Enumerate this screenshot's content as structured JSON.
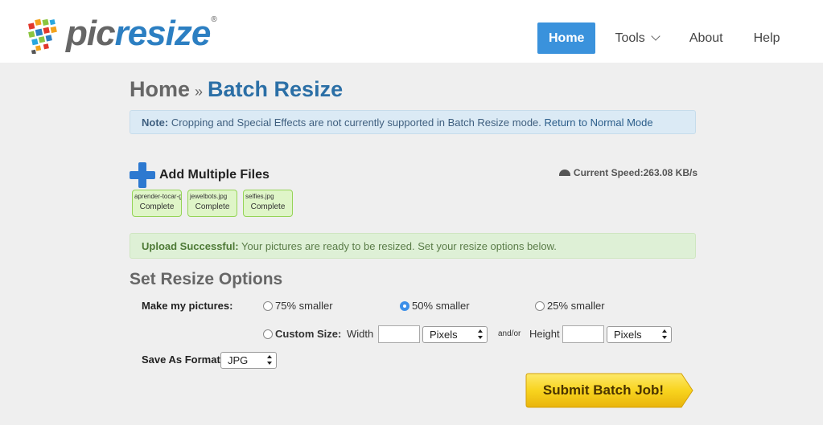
{
  "header": {
    "logo": {
      "pic": "pic",
      "resize": "resize",
      "reg": "®"
    },
    "nav": [
      {
        "label": "Home",
        "active": true
      },
      {
        "label": "Tools",
        "dropdown": true
      },
      {
        "label": "About"
      },
      {
        "label": "Help"
      }
    ]
  },
  "breadcrumb": {
    "home": "Home",
    "separator": "»",
    "current": "Batch Resize"
  },
  "note": {
    "label": "Note:",
    "text": " Cropping and Special Effects are not currently supported in Batch Resize mode. ",
    "link": "Return to Normal Mode"
  },
  "upload": {
    "add_label": "Add Multiple Files",
    "speed_label": "Current Speed:",
    "speed_value": " 263.08 KB/s",
    "files": [
      {
        "name": "aprender-tocar-g",
        "status": "Complete"
      },
      {
        "name": "jewelbots.jpg",
        "status": "Complete"
      },
      {
        "name": "selfies.jpg",
        "status": "Complete"
      }
    ]
  },
  "success": {
    "label": "Upload Successful:",
    "text": " Your pictures are ready to be resized. Set your resize options below."
  },
  "options": {
    "title": "Set Resize Options",
    "make_label": "Make my pictures:",
    "choices": [
      {
        "label": "75% smaller",
        "selected": false
      },
      {
        "label": "50% smaller",
        "selected": true
      },
      {
        "label": "25% smaller",
        "selected": false
      }
    ],
    "custom_label": "Custom Size:",
    "width_label": "Width",
    "width_unit": "Pixels",
    "andor": "and/or",
    "height_label": "Height",
    "height_unit": "Pixels",
    "format_label": "Save As Format:",
    "format_value": "JPG"
  },
  "submit_label": "Submit Batch Job!",
  "colors": {
    "accent": "#3a92dc",
    "title_blue": "#2b6fa6",
    "submit_yellow": "#f7d21c"
  }
}
